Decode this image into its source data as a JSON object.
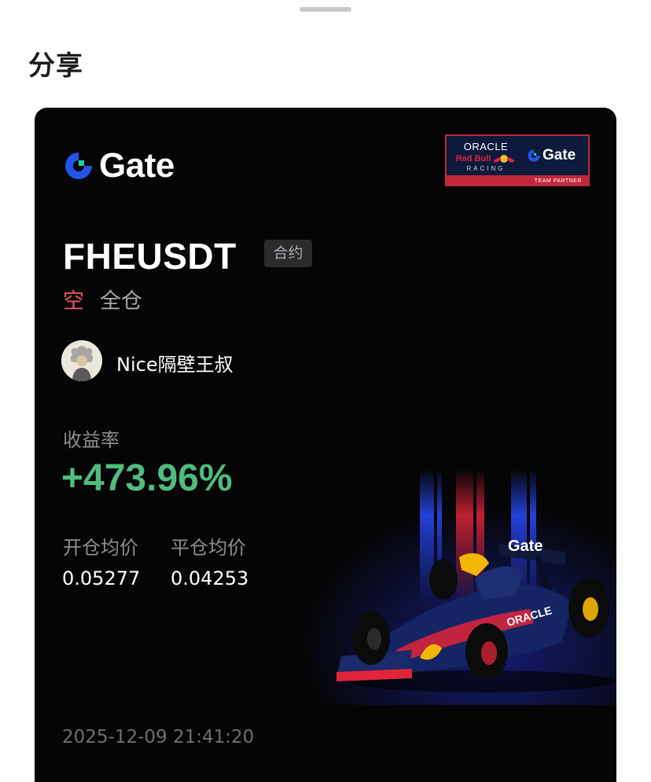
{
  "sheet": {
    "title": "分享"
  },
  "brand": {
    "logo_text": "Gate",
    "accent": "#2354e6",
    "accent_2": "#17d4a0"
  },
  "partner": {
    "oracle": "ORACLE",
    "redbull": "Red Bull",
    "racing": "RACING",
    "gate": "Gate",
    "team_partner": "TEAM PARTNER"
  },
  "position": {
    "pair": "FHEUSDT",
    "type_badge": "合约",
    "direction": "空",
    "margin_mode": "全仓",
    "direction_color": "#e5555c"
  },
  "user": {
    "name": "Nice隔壁王叔"
  },
  "stats": {
    "roi_label": "收益率",
    "roi_value": "+473.96%",
    "roi_color": "#4fbc7f",
    "entry_label": "开仓均价",
    "entry_value": "0.05277",
    "exit_label": "平仓均价",
    "exit_value": "0.04253"
  },
  "timestamp": "2025-12-09 21:41:20",
  "car_livery": {
    "livery_text": "Gate",
    "sponsor_text": "ORACLE"
  }
}
